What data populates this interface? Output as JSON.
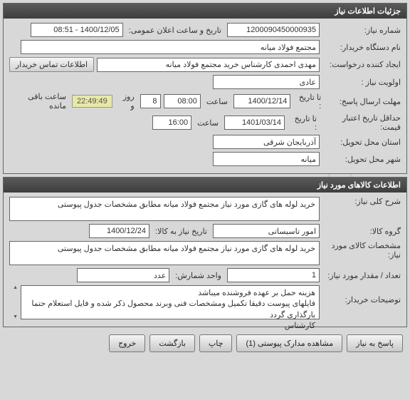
{
  "watermark": "سامانه تدارکات الکترونیکی دولت",
  "section1": {
    "title": "جزئیات اطلاعات نیاز",
    "need_number_label": "شماره نیاز:",
    "need_number": "1200090450000935",
    "announce_label": "تاریخ و ساعت اعلان عمومی:",
    "announce_value": "1400/12/05 - 08:51",
    "buyer_label": "نام دستگاه خریدار:",
    "buyer_value": "مجتمع فولاد میانه",
    "requester_label": "ایجاد کننده درخواست:",
    "requester_value": "مهدی احمدی کارشناس خرید مجتمع فولاد میانه",
    "contact_btn": "اطلاعات تماس خریدار",
    "priority_label": "اولویت نیاز :",
    "priority_value": "عادی",
    "deadline_label": "مهلت ارسال پاسخ:",
    "to_date_label": "تا تاریخ :",
    "deadline_date": "1400/12/14",
    "time_label": "ساعت",
    "deadline_time": "08:00",
    "days_value": "8",
    "days_suffix": "روز و",
    "countdown": "22:49:49",
    "remaining": "ساعت باقی مانده",
    "validity_label": "حداقل تاریخ اعتبار قیمت:",
    "validity_date": "1401/03/14",
    "validity_time": "16:00",
    "province_label": "استان محل تحویل:",
    "province_value": "آذربایجان شرقی",
    "city_label": "شهر محل تحویل:",
    "city_value": "میانه"
  },
  "section2": {
    "title": "اطلاعات کالاهای مورد نیاز",
    "desc_label": "شرح کلی نیاز:",
    "desc_value": "خرید لوله  های گازی مورد نیاز  مجتمع فولاد میانه مطابق مشخصات جدول پیوستی",
    "group_label": "گروه کالا:",
    "group_value": "امور تاسیساتی",
    "need_date_label": "تاریخ نیاز به کالا:",
    "need_date_value": "1400/12/24",
    "spec_label": "مشخصات کالای مورد نیاز:",
    "spec_value": "خرید لوله  های گازی مورد نیاز  مجتمع فولاد میانه مطابق مشخصات جدول پیوستی",
    "qty_label": "تعداد / مقدار مورد نیاز:",
    "qty_value": "1",
    "unit_label": "واحد شمارش:",
    "unit_value": "عدد",
    "notes_label": "توضیحات خریدار:",
    "notes_value": "هزینه حمل بر عهده فروشنده میباشد\nفایلهای پیوست دقیقا تکمیل ومشخصات فنی وبرند محصول ذکر شده و فایل استعلام حتما بارگذاری گردد\nکارشناس"
  },
  "footer": {
    "respond": "پاسخ به نیاز",
    "attachments": "مشاهده مدارک پیوستی (1)",
    "print": "چاپ",
    "back": "بازگشت",
    "exit": "خروج"
  }
}
